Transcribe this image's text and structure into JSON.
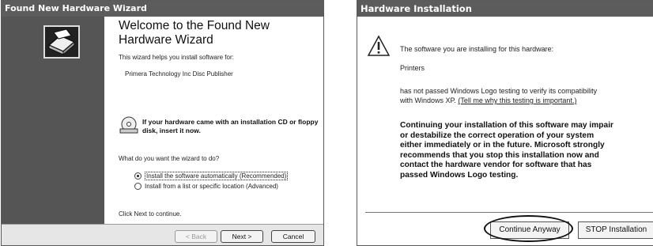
{
  "wizard": {
    "title": "Found New Hardware Wizard",
    "heading": "Welcome to the Found New Hardware Wizard",
    "intro": "This wizard helps you install software for:",
    "device": "Primera Technology Inc Disc Publisher",
    "cd_prompt": "If your hardware came with an installation CD or floppy disk, insert it now.",
    "question": "What do you want the wizard to do?",
    "option_auto": "Install the software automatically (Recommended)",
    "option_manual": "Install from a list or specific location (Advanced)",
    "continue_hint": "Click Next to continue.",
    "back_label": "< Back",
    "next_label": "Next >",
    "cancel_label": "Cancel"
  },
  "hardware_install": {
    "title": "Hardware Installation",
    "line1": "The software you are installing for this hardware:",
    "device": "Printers",
    "line2a": "has not passed Windows Logo testing to verify its compatibility",
    "line2b": "with Windows XP.",
    "link": "(Tell me why this testing is important.)",
    "warning_lines": [
      "Continuing your installation of this software may impair",
      "or destabilize the correct operation of your system",
      "either immediately or in the future. Microsoft strongly",
      "recommends that you stop this installation now and",
      "contact the hardware vendor for software that has",
      "passed Windows Logo testing."
    ],
    "continue_label": "Continue Anyway",
    "stop_label": "STOP Installation"
  }
}
